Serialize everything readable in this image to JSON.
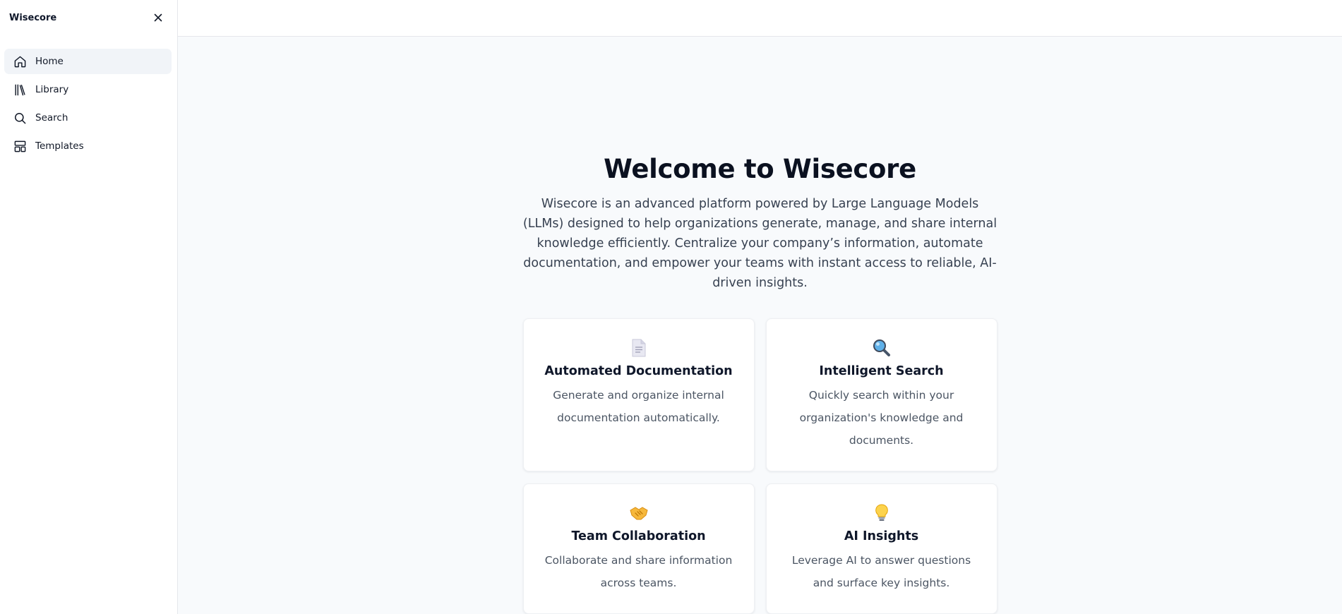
{
  "app": {
    "brand": "Wisecore"
  },
  "sidebar": {
    "items": [
      {
        "label": "Home",
        "icon": "home-icon",
        "active": true
      },
      {
        "label": "Library",
        "icon": "library-icon",
        "active": false
      },
      {
        "label": "Search",
        "icon": "search-icon",
        "active": false
      },
      {
        "label": "Templates",
        "icon": "templates-icon",
        "active": false
      }
    ]
  },
  "main": {
    "title": "Welcome to Wisecore",
    "intro": "Wisecore is an advanced platform powered by Large Language Models (LLMs) designed to help organizations generate, manage, and share internal knowledge efficiently. Centralize your company’s information, automate documentation, and empower your teams with instant access to reliable, AI-driven insights.",
    "cards": [
      {
        "icon": "document-icon",
        "title": "Automated Documentation",
        "description": "Generate and organize internal documentation automatically."
      },
      {
        "icon": "magnifier-icon",
        "title": "Intelligent Search",
        "description": "Quickly search within your organization's knowledge and documents."
      },
      {
        "icon": "handshake-icon",
        "title": "Team Collaboration",
        "description": "Collaborate and share information across teams."
      },
      {
        "icon": "lightbulb-icon",
        "title": "AI Insights",
        "description": "Leverage AI to answer questions and surface key insights."
      }
    ]
  },
  "colors": {
    "sidebar_active": "#f1f4f8",
    "main_background": "#f8fafc",
    "border": "#e5e7eb"
  }
}
